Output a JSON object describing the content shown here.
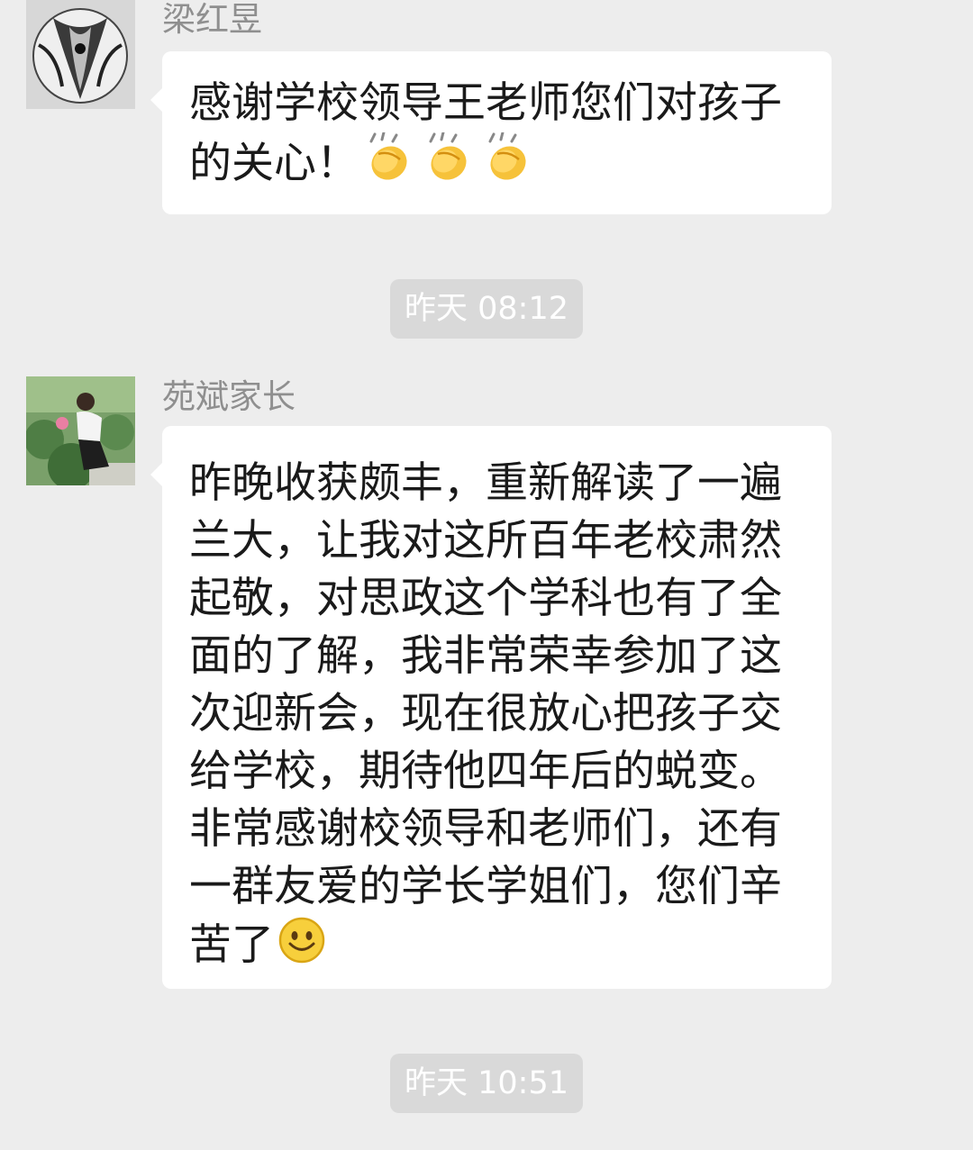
{
  "messages": [
    {
      "sender": "梁红昱",
      "text": "感谢学校领导王老师您们对孩子的关心！",
      "emojis": [
        "clapping-hands-icon",
        "clapping-hands-icon",
        "clapping-hands-icon"
      ]
    },
    {
      "sender": "苑斌家长",
      "text": "昨晚收获颇丰，重新解读了一遍兰大，让我对这所百年老校肃然起敬，对思政这个学科也有了全面的了解，我非常荣幸参加了这次迎新会，现在很放心把孩子交给学校，期待他四年后的蜕变。非常感谢校领导和老师们，还有一群友爱的学长学姐们，您们辛苦了",
      "emojis": [
        "smiley-face-icon"
      ]
    }
  ],
  "timestamps": [
    "昨天 08:12",
    "昨天 10:51"
  ],
  "colors": {
    "background": "#ededed",
    "bubble": "#ffffff",
    "timestamp_bg": "#d9d9d9",
    "sender_name": "#8f8f8f"
  }
}
